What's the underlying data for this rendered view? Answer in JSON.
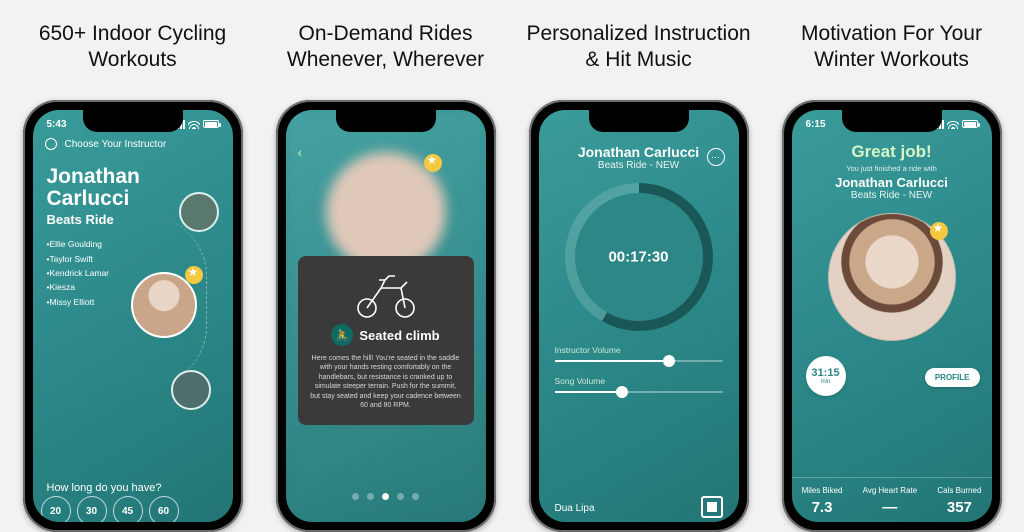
{
  "panels": [
    {
      "headline": "650+ Indoor Cycling Workouts",
      "status_time": "5:43",
      "topbar_label": "Choose Your Instructor",
      "instructor_first": "Jonathan",
      "instructor_last": "Carlucci",
      "ride_name": "Beats Ride",
      "artists": [
        "•Ellie Goulding",
        "•Taylor Swift",
        "•Kendrick Lamar",
        "•Kiesza",
        "•Missy Elliott"
      ],
      "howlong_label": "How long do you have?",
      "durations": [
        "20",
        "30",
        "45",
        "60"
      ]
    },
    {
      "headline": "On-Demand Rides Whenever, Wherever",
      "move_name": "Seated climb",
      "description": "Here comes the hill! You're seated in the saddle with your hands resting comfortably on the handlebars, but resistance is cranked up to simulate steeper terrain. Push for the summit, but stay seated and keep your cadence between 60 and 80 RPM."
    },
    {
      "headline": "Personalized Instruction & Hit Music",
      "instructor": "Jonathan Carlucci",
      "ride_name": "Beats Ride - NEW",
      "timer": "00:17:30",
      "slider1_label": "Instructor Volume",
      "slider1_pct": 68,
      "slider2_label": "Song Volume",
      "slider2_pct": 40,
      "song": "Dua Lipa"
    },
    {
      "headline": "Motivation For Your Winter Workouts",
      "status_time": "6:15",
      "great_job": "Great job!",
      "finished_text": "You just finished a ride with",
      "instructor": "Jonathan Carlucci",
      "ride_name": "Beats Ride - NEW",
      "duration_value": "31:15",
      "duration_unit": "min",
      "profile_label": "PROFILE",
      "stats": [
        {
          "label": "Miles Biked",
          "value": "7.3"
        },
        {
          "label": "Avg Heart Rate",
          "value": "—"
        },
        {
          "label": "Cals Burned",
          "value": "357"
        }
      ]
    }
  ]
}
